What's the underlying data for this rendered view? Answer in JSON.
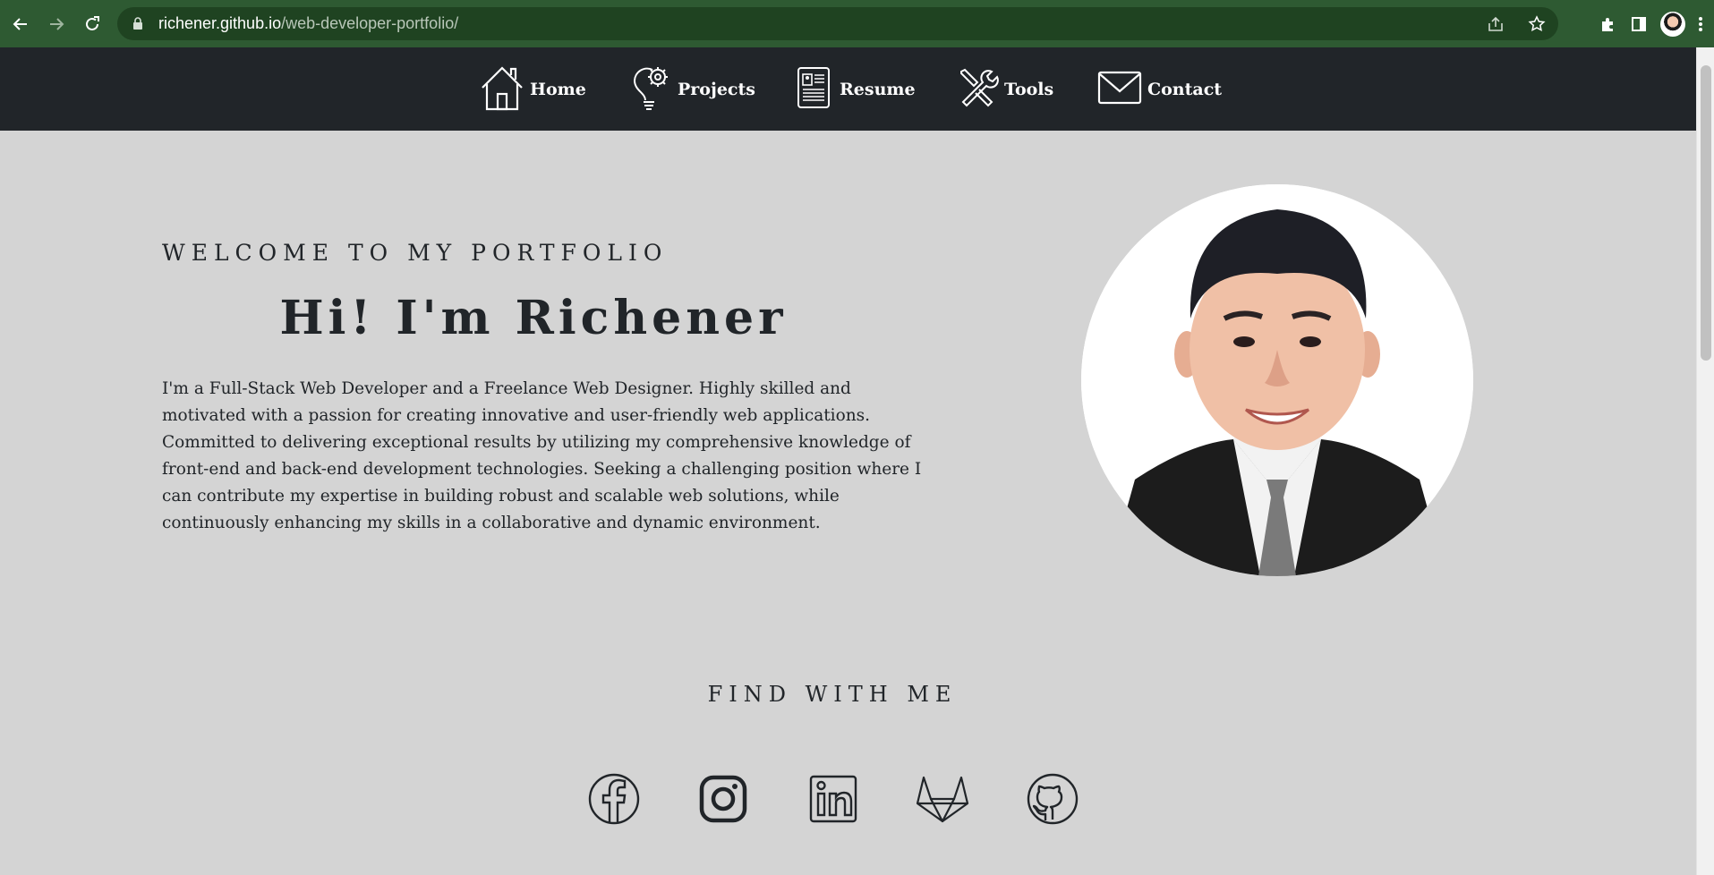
{
  "browser": {
    "url_host": "richener.github.io",
    "url_path": "/web-developer-portfolio/"
  },
  "nav": {
    "items": [
      {
        "label": "Home",
        "icon": "home-icon"
      },
      {
        "label": "Projects",
        "icon": "lightbulb-gear-icon"
      },
      {
        "label": "Resume",
        "icon": "resume-icon"
      },
      {
        "label": "Tools",
        "icon": "tools-icon"
      },
      {
        "label": "Contact",
        "icon": "envelope-icon"
      }
    ]
  },
  "hero": {
    "welcome": "WELCOME TO MY PORTFOLIO",
    "greeting": "Hi! I'm Richener",
    "about": "I'm a Full-Stack Web Developer and a Freelance Web Designer. Highly skilled and motivated with a passion for creating innovative and user-friendly web applications. Committed to delivering exceptional results by utilizing my comprehensive knowledge of front-end and back-end development technologies. Seeking a challenging position where I can contribute my expertise in building robust and scalable web solutions, while continuously enhancing my skills in a collaborative and dynamic environment."
  },
  "social": {
    "heading": "FIND WITH ME",
    "links": [
      {
        "name": "facebook-icon"
      },
      {
        "name": "instagram-icon"
      },
      {
        "name": "linkedin-icon"
      },
      {
        "name": "gitlab-icon"
      },
      {
        "name": "github-icon"
      }
    ]
  },
  "colors": {
    "chrome": "#2e5a32",
    "nav_bg": "#212529",
    "page_bg": "#d4d4d4",
    "text": "#212529"
  }
}
